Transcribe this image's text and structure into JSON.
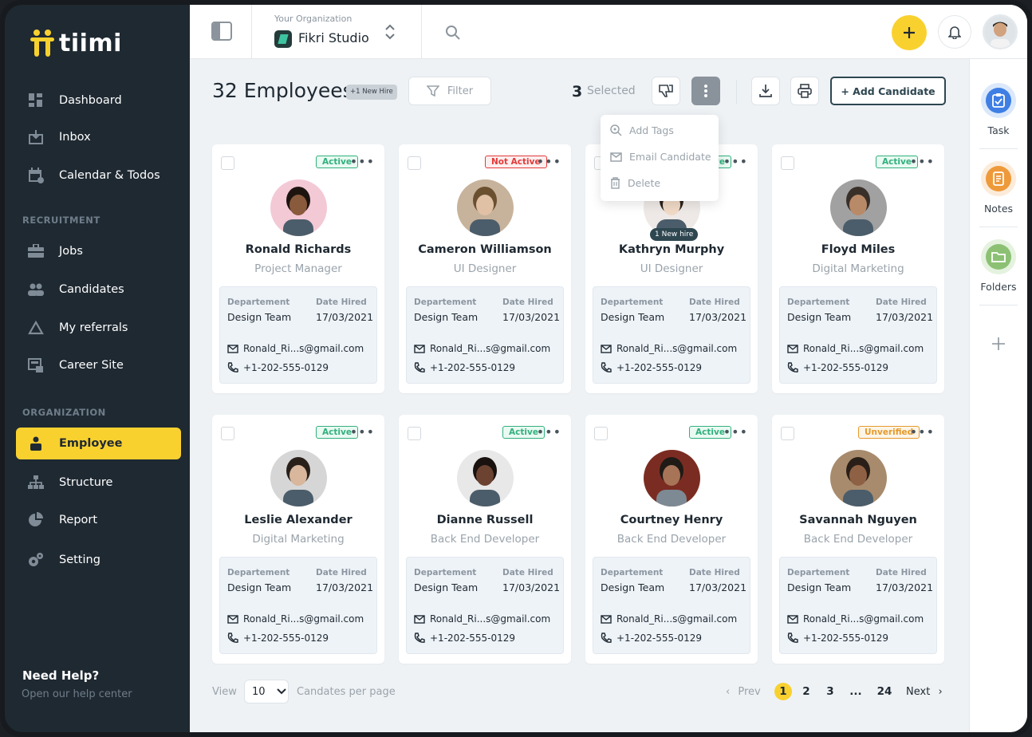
{
  "brand": {
    "name": "tiimi",
    "accent": "#f9d12f",
    "sidebar_bg": "#1f2932"
  },
  "sidebar": {
    "items": [
      {
        "label": "Dashboard",
        "icon": "dashboard-icon"
      },
      {
        "label": "Inbox",
        "icon": "inbox-icon"
      },
      {
        "label": "Calendar & Todos",
        "icon": "calendar-icon"
      }
    ],
    "recruitment_label": "RECRUITMENT",
    "recruitment_items": [
      {
        "label": "Jobs",
        "icon": "briefcase-icon"
      },
      {
        "label": "Candidates",
        "icon": "people-icon"
      },
      {
        "label": "My referrals",
        "icon": "triangle-icon"
      },
      {
        "label": "Career Site",
        "icon": "career-site-icon"
      }
    ],
    "organization_label": "ORGANIZATION",
    "organization_items": [
      {
        "label": "Employee",
        "icon": "person-icon",
        "active": true
      },
      {
        "label": "Structure",
        "icon": "hierarchy-icon"
      },
      {
        "label": "Report",
        "icon": "pie-chart-icon"
      },
      {
        "label": "Setting",
        "icon": "gear-icon"
      }
    ],
    "help_title": "Need Help?",
    "help_sub": "Open our help center"
  },
  "topbar": {
    "org_label": "Your Organization",
    "org_name": "Fikri Studio"
  },
  "rail": {
    "task": "Task",
    "notes": "Notes",
    "folders": "Folders"
  },
  "toolbar": {
    "count_title": "32 Employees",
    "new_hire_badge": "+1 New Hire",
    "filter": "Filter",
    "selected_count": "3",
    "selected_label": "Selected",
    "add_candidate": "+ Add Candidate"
  },
  "dropdown": {
    "items": [
      "Add Tags",
      "Email Candidate",
      "Delete"
    ]
  },
  "card_labels": {
    "department": "Departement",
    "date_hired": "Date Hired"
  },
  "employees": [
    {
      "name": "Ronald Richards",
      "role": "Project Manager",
      "status": "Active",
      "department": "Design Team",
      "date": "17/03/2021",
      "email": "Ronald_Ri...s@gmail.com",
      "phone": "+1-202-555-0129"
    },
    {
      "name": "Cameron Williamson",
      "role": "UI Designer",
      "status": "Not Active",
      "department": "Design Team",
      "date": "17/03/2021",
      "email": "Ronald_Ri...s@gmail.com",
      "phone": "+1-202-555-0129"
    },
    {
      "name": "Kathryn Murphy",
      "role": "UI Designer",
      "status": "Active",
      "badge": "1 New hire",
      "department": "Design Team",
      "date": "17/03/2021",
      "email": "Ronald_Ri...s@gmail.com",
      "phone": "+1-202-555-0129"
    },
    {
      "name": "Floyd Miles",
      "role": "Digital Marketing",
      "status": "Active",
      "department": "Design Team",
      "date": "17/03/2021",
      "email": "Ronald_Ri...s@gmail.com",
      "phone": "+1-202-555-0129"
    },
    {
      "name": "Leslie Alexander",
      "role": "Digital Marketing",
      "status": "Active",
      "department": "Design Team",
      "date": "17/03/2021",
      "email": "Ronald_Ri...s@gmail.com",
      "phone": "+1-202-555-0129"
    },
    {
      "name": "Dianne Russell",
      "role": "Back End Developer",
      "status": "Active",
      "department": "Design Team",
      "date": "17/03/2021",
      "email": "Ronald_Ri...s@gmail.com",
      "phone": "+1-202-555-0129"
    },
    {
      "name": "Courtney Henry",
      "role": "Back End Developer",
      "status": "Active",
      "department": "Design Team",
      "date": "17/03/2021",
      "email": "Ronald_Ri...s@gmail.com",
      "phone": "+1-202-555-0129"
    },
    {
      "name": "Savannah Nguyen",
      "role": "Back End Developer",
      "status": "Unverified",
      "department": "Design Team",
      "date": "17/03/2021",
      "email": "Ronald_Ri...s@gmail.com",
      "phone": "+1-202-555-0129"
    }
  ],
  "pagination": {
    "view": "View",
    "per_page_value": "10",
    "per_page_label": "Candates per page",
    "prev": "Prev",
    "pages": [
      "1",
      "2",
      "3",
      "...",
      "24"
    ],
    "current": "1",
    "next": "Next"
  }
}
